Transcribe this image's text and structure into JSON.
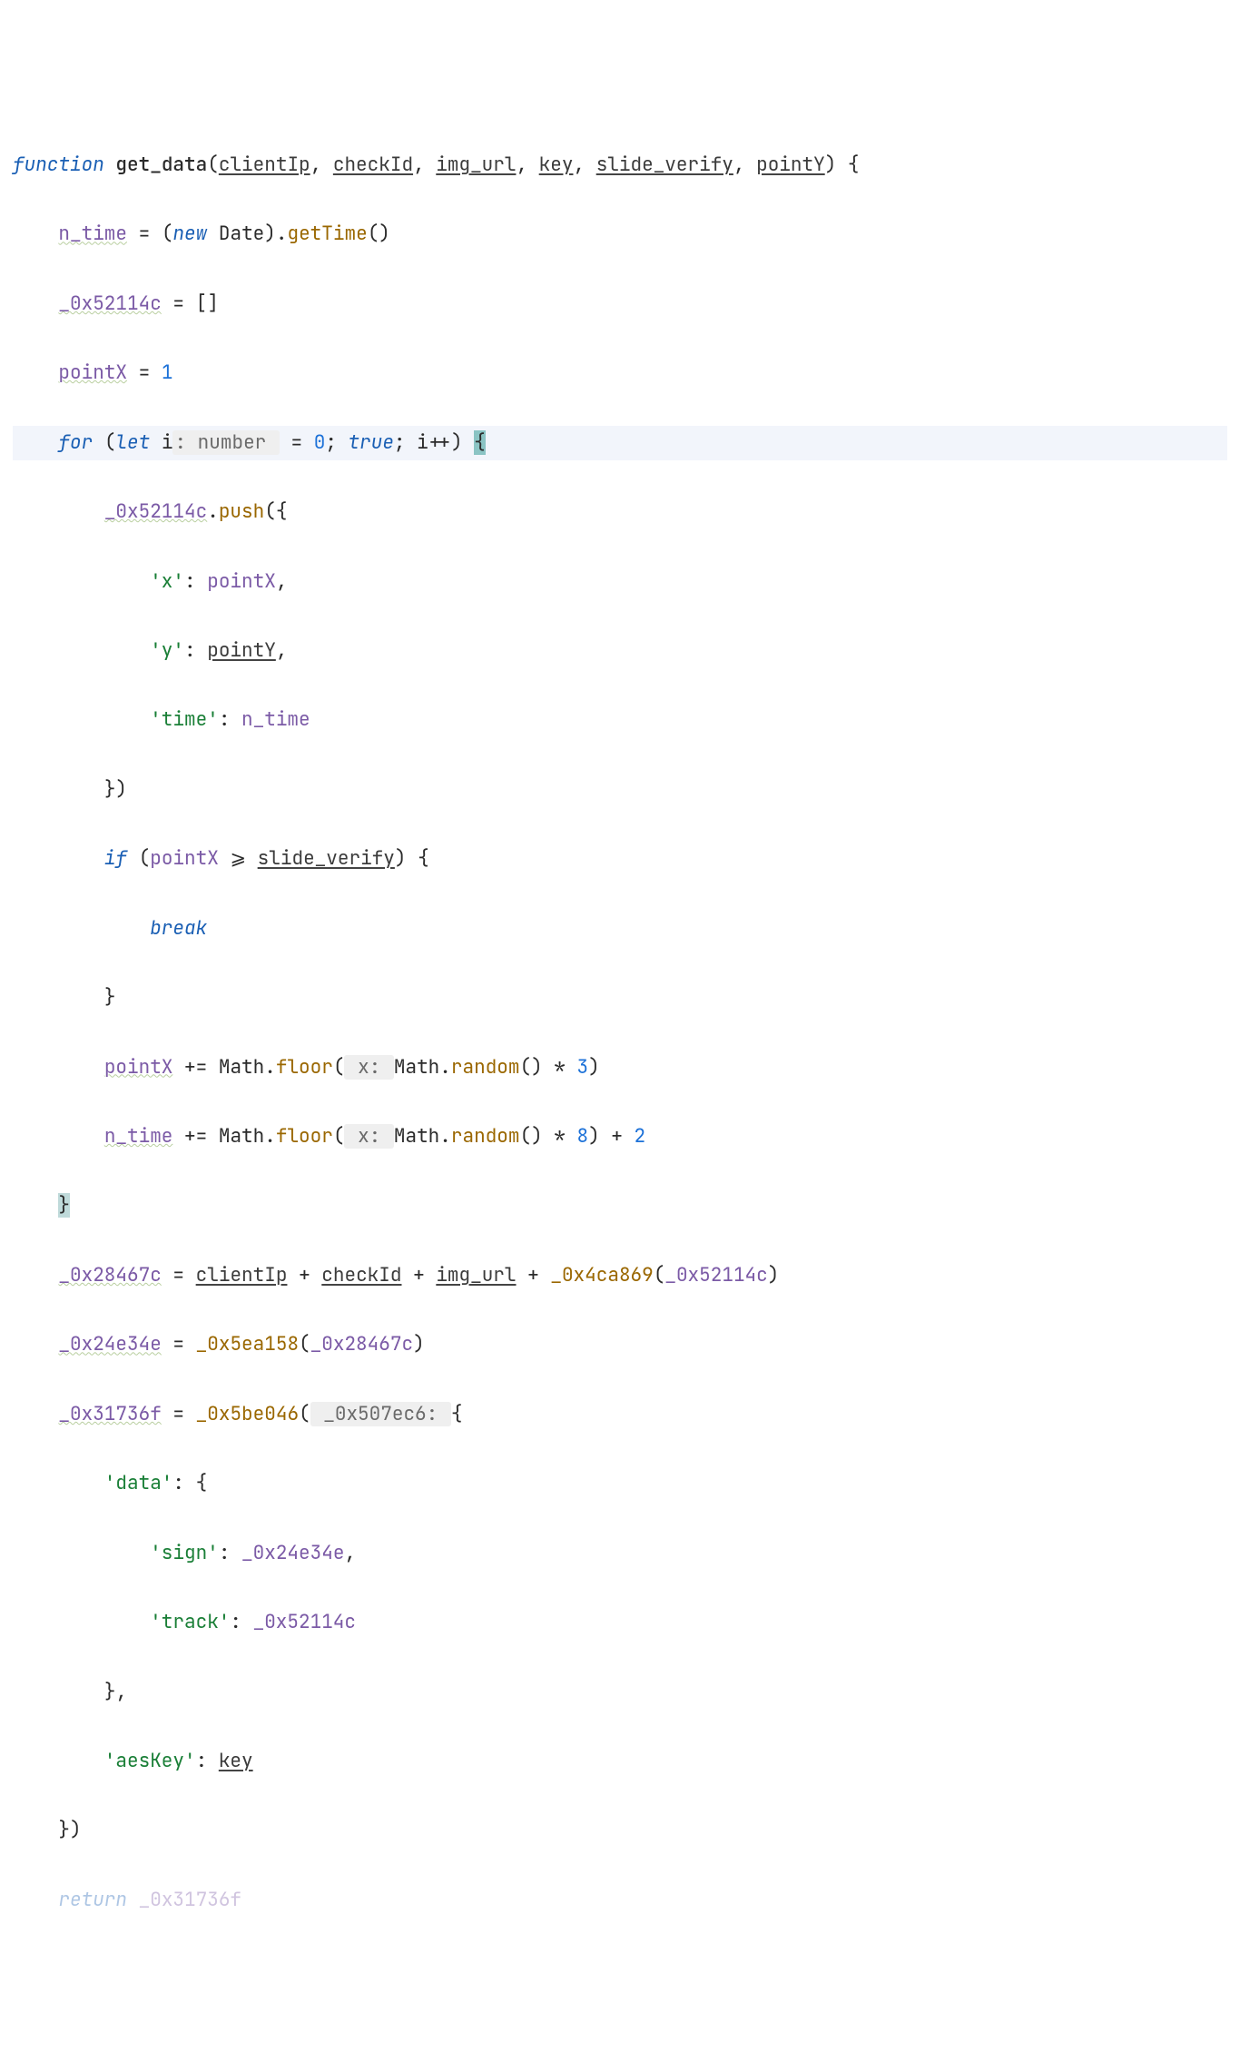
{
  "l1": {
    "kw_function": "function",
    "fname": "get_data",
    "p1": "clientIp",
    "p2": "checkId",
    "p3": "img_url",
    "p4": "key",
    "p5": "slide_verify",
    "p6": "pointY"
  },
  "l2": {
    "v": "n_time",
    "kw_new": "new",
    "obj": "Date",
    "m": "getTime"
  },
  "l3": {
    "v": "_0x52114c"
  },
  "l4": {
    "v": "pointX",
    "n": "1"
  },
  "l5": {
    "kw_for": "for",
    "kw_let": "let",
    "var_i": "i",
    "hint": ": number ",
    "n0": "0",
    "b": "true",
    "inc": "i++"
  },
  "l6": {
    "v": "_0x52114c",
    "m": "push"
  },
  "l7": {
    "k": "'x'",
    "v": "pointX"
  },
  "l8": {
    "k": "'y'",
    "v": "pointY"
  },
  "l9": {
    "k": "'time'",
    "v": "n_time"
  },
  "l11": {
    "kw_if": "if",
    "v": "pointX",
    "p": "slide_verify"
  },
  "l12": {
    "kw": "break"
  },
  "l14": {
    "v": "pointX",
    "obj": "Math",
    "m1": "floor",
    "hint": " x: ",
    "m2": "random",
    "n": "3"
  },
  "l15": {
    "v": "n_time",
    "obj": "Math",
    "m1": "floor",
    "hint": " x: ",
    "m2": "random",
    "n": "8",
    "n2": "2"
  },
  "l17": {
    "v": "_0x28467c",
    "p1": "clientIp",
    "p2": "checkId",
    "p3": "img_url",
    "fn": "_0x4ca869",
    "arg": "_0x52114c"
  },
  "l18": {
    "v": "_0x24e34e",
    "fn": "_0x5ea158",
    "arg": "_0x28467c"
  },
  "l19": {
    "v": "_0x31736f",
    "fn": "_0x5be046",
    "hint": " _0x507ec6: "
  },
  "l20": {
    "k": "'data'"
  },
  "l21": {
    "k": "'sign'",
    "v": "_0x24e34e"
  },
  "l22": {
    "k": "'track'",
    "v": "_0x52114c"
  },
  "l24": {
    "k": "'aesKey'",
    "v": "key"
  },
  "l26": {
    "kw": "return",
    "v": "_0x31736f"
  }
}
